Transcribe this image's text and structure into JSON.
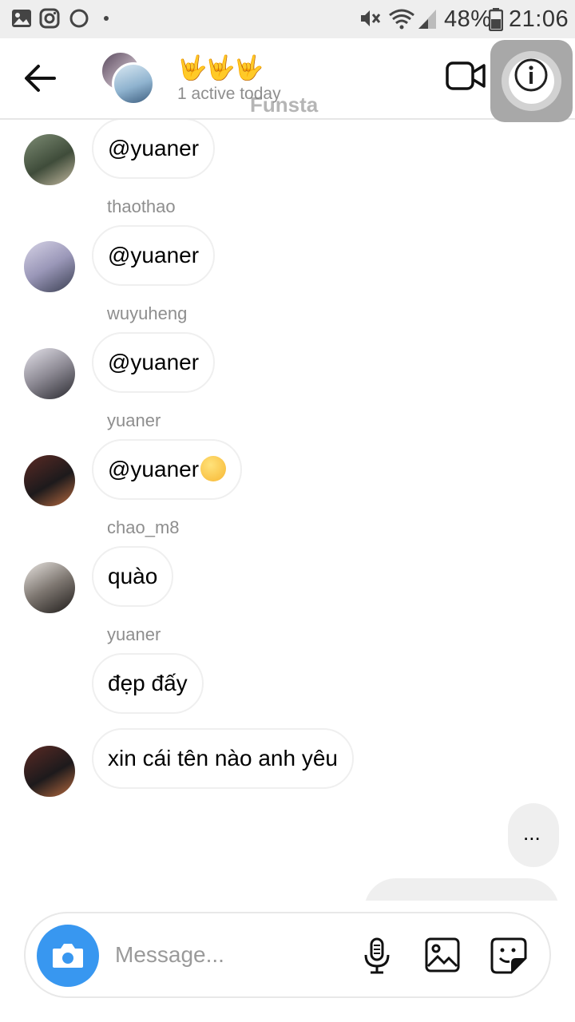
{
  "status_bar": {
    "battery": "48%",
    "time": "21:06"
  },
  "header": {
    "title": "🤟🤟🤟",
    "subtitle": "1 active today",
    "watermark": "Funsta"
  },
  "messages": [
    {
      "sender": "",
      "text": "@yuaner"
    },
    {
      "sender": "thaothao",
      "text": "@yuaner"
    },
    {
      "sender": "wuyuheng",
      "text": "@yuaner"
    },
    {
      "sender": "yuaner",
      "text": "@yuaner"
    },
    {
      "sender": "chao_m8",
      "text": "quào"
    },
    {
      "sender": "yuaner",
      "text": "đẹp đấy"
    },
    {
      "sender": "",
      "text": "xin cái tên nào anh yêu"
    },
    {
      "sender": "",
      "text": "..."
    }
  ],
  "composer": {
    "placeholder": "Message..."
  },
  "colors": {
    "accent": "#3897f0",
    "bubble_border": "#efefef",
    "sender_text": "#8e8e8e",
    "status_bar_bg": "#eeeeee"
  },
  "icons": [
    "gallery-icon",
    "instagram-icon",
    "circle-icon",
    "dot-icon",
    "mute-icon",
    "wifi-icon",
    "signal-icon",
    "battery-icon",
    "back-arrow-icon",
    "video-camera-icon",
    "info-icon",
    "camera-icon",
    "microphone-icon",
    "image-icon",
    "sticker-icon",
    "smiling-face-icon"
  ]
}
